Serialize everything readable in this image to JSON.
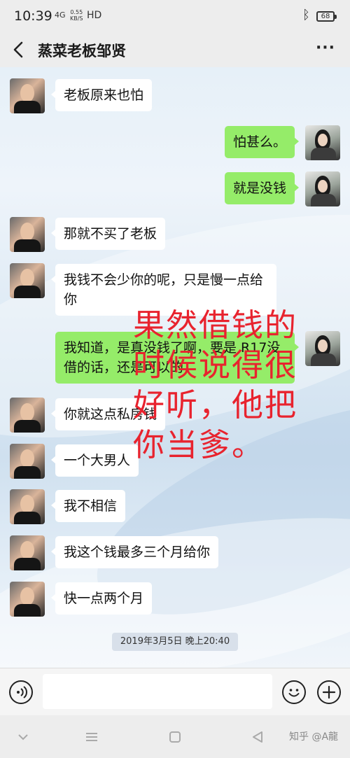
{
  "status_bar": {
    "time": "10:39",
    "network": "4G",
    "speed_value": "0.55",
    "speed_unit": "KB/S",
    "hd": "HD",
    "battery": "68"
  },
  "header": {
    "title": "蒸菜老板邹贤"
  },
  "messages": [
    {
      "side": "left",
      "text": "老板原来也怕"
    },
    {
      "side": "right",
      "text": "怕甚么。"
    },
    {
      "side": "right",
      "text": "就是没钱"
    },
    {
      "side": "left",
      "text": "那就不买了老板"
    },
    {
      "side": "left",
      "text": "我钱不会少你的呢，只是慢一点给你"
    },
    {
      "side": "right",
      "text": "我知道，是真没钱了啊，要是 R17没借的话，还是可以的"
    },
    {
      "side": "left",
      "text": "你就这点私房钱"
    },
    {
      "side": "left",
      "text": "一个大男人"
    },
    {
      "side": "left",
      "text": "我不相信"
    },
    {
      "side": "left",
      "text": "我这个钱最多三个月给你"
    },
    {
      "side": "left",
      "text": "快一点两个月"
    }
  ],
  "timestamp": "2019年3月5日 晚上20:40",
  "overlay_text": [
    "果然借钱的",
    "时候说得很",
    "好听，他把",
    "你当爹。"
  ],
  "input": {
    "placeholder": ""
  },
  "watermark": "知乎 @A龍",
  "colors": {
    "outgoing_bubble": "#95ec69",
    "incoming_bubble": "#ffffff",
    "overlay_text": "#e8232e"
  }
}
